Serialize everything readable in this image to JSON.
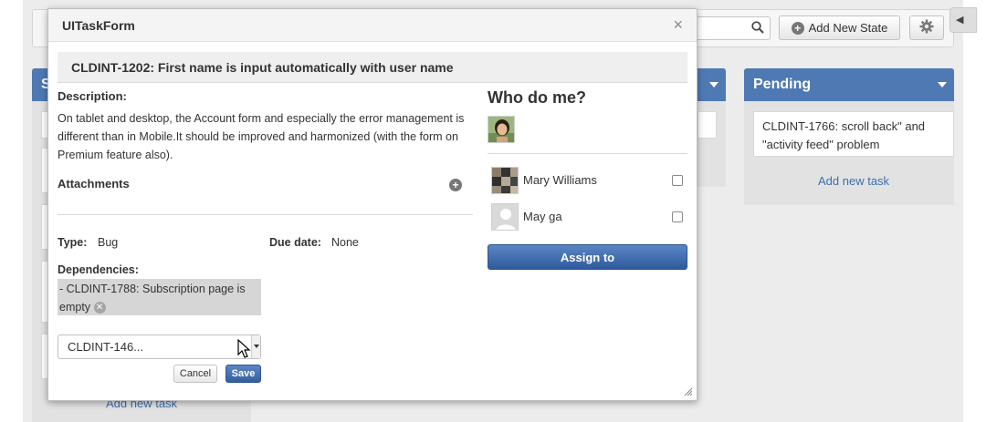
{
  "board": {
    "toolbar": {
      "add_state_label": "Add New State"
    },
    "left_column": {
      "header_letter": "S",
      "add_task_label": "Add new task"
    },
    "pending": {
      "header": "Pending",
      "task_text": "CLDINT-1766: scroll back\" and \"activity feed\" problem",
      "add_task_label": "Add new task"
    }
  },
  "modal": {
    "title": "UITaskForm",
    "close_label": "×",
    "task_title": "CLDINT-1202: First name is input automatically with user name",
    "description_label": "Description:",
    "description_text": "On tablet and desktop, the Account form and especially the error management is different than in Mobile.It should be improved and harmonized (with the form on Premium feature also).",
    "attachments_label": "Attachments",
    "type_label": "Type:",
    "type_value": "Bug",
    "due_date_label": "Due date:",
    "due_date_value": "None",
    "dependencies_label": "Dependencies:",
    "dependency_item": "- CLDINT-1788: Subscription page is empty",
    "dependency_input_value": "CLDINT-146...",
    "cancel_label": "Cancel",
    "save_label": "Save",
    "who_title": "Who do me?",
    "assignees": [
      {
        "name": "Mary Williams"
      },
      {
        "name": "May ga"
      }
    ],
    "assign_label": "Assign to"
  },
  "colors": {
    "accent": "#4f79b3",
    "primary_button": "#3d68a8"
  },
  "icons": {
    "search": "magnifier",
    "settings": "gear",
    "add": "plus-circle",
    "remove": "x-circle"
  }
}
